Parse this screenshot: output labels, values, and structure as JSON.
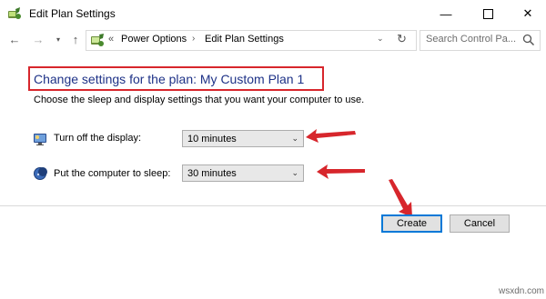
{
  "window": {
    "title": "Edit Plan Settings",
    "min_glyph": "—",
    "close_glyph": "✕"
  },
  "nav": {
    "back_glyph": "←",
    "forward_glyph": "→",
    "recent_glyph": "▾",
    "up_glyph": "↑",
    "address_prefix": "«",
    "breadcrumbs": [
      "Power Options",
      "Edit Plan Settings"
    ],
    "crumb_separator": "›",
    "dropdown_glyph": "⌄",
    "refresh_glyph": "↻",
    "search_placeholder": "Search Control Pa..."
  },
  "content": {
    "heading": "Change settings for the plan: My Custom Plan 1",
    "subtext": "Choose the sleep and display settings that you want your computer to use.",
    "settings": [
      {
        "label": "Turn off the display:",
        "value": "10 minutes",
        "icon": "monitor-icon"
      },
      {
        "label": "Put the computer to sleep:",
        "value": "30 minutes",
        "icon": "moon-icon"
      }
    ],
    "select_chevron": "⌄"
  },
  "buttons": {
    "create": "Create",
    "cancel": "Cancel"
  },
  "watermark": "wsxdn.com",
  "colors": {
    "annotation_red": "#d7262c",
    "heading_blue": "#1e3287",
    "focus_blue": "#0078d7"
  }
}
